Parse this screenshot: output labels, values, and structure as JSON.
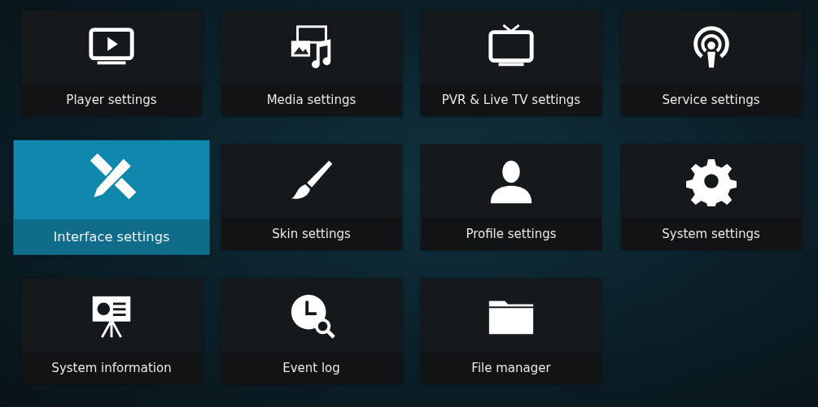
{
  "tiles": [
    {
      "label": "Player settings",
      "selected": false
    },
    {
      "label": "Media settings",
      "selected": false
    },
    {
      "label": "PVR & Live TV settings",
      "selected": false
    },
    {
      "label": "Service settings",
      "selected": false
    },
    {
      "label": "Interface settings",
      "selected": true
    },
    {
      "label": "Skin settings",
      "selected": false
    },
    {
      "label": "Profile settings",
      "selected": false
    },
    {
      "label": "System settings",
      "selected": false
    },
    {
      "label": "System information",
      "selected": false
    },
    {
      "label": "Event log",
      "selected": false
    },
    {
      "label": "File manager",
      "selected": false
    }
  ]
}
